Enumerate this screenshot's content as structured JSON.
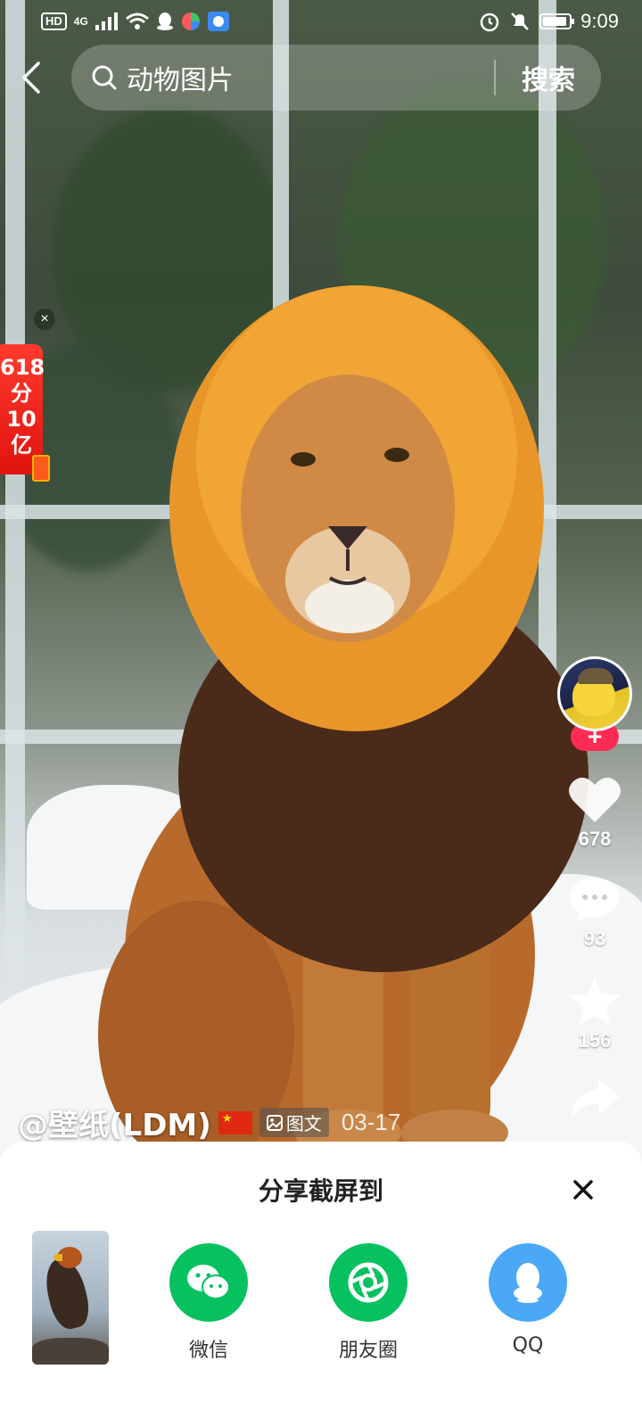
{
  "status_bar": {
    "network_hd": "HD",
    "network_4g": "4G",
    "time": "9:09"
  },
  "search": {
    "query": "动物图片",
    "button_label": "搜索"
  },
  "promo": {
    "line1": "618",
    "line2": "分",
    "line3": "10",
    "line4": "亿",
    "close_glyph": "×"
  },
  "rail": {
    "follow_glyph": "+",
    "likes": "678",
    "comments": "93",
    "favorites": "156"
  },
  "post": {
    "author": "@壁纸(LDM)",
    "type_label": "图文",
    "date": "03-17"
  },
  "share_sheet": {
    "title": "分享截屏到",
    "options": [
      {
        "label": "微信",
        "icon": "wechat-icon",
        "color": "#07c160"
      },
      {
        "label": "朋友圈",
        "icon": "moments-icon",
        "color": "#07c160"
      },
      {
        "label": "QQ",
        "icon": "qq-icon",
        "color": "#4aa8f7"
      }
    ]
  },
  "colors": {
    "accent_red": "#fe2c55",
    "wechat_green": "#07c160",
    "qq_blue": "#4aa8f7"
  }
}
